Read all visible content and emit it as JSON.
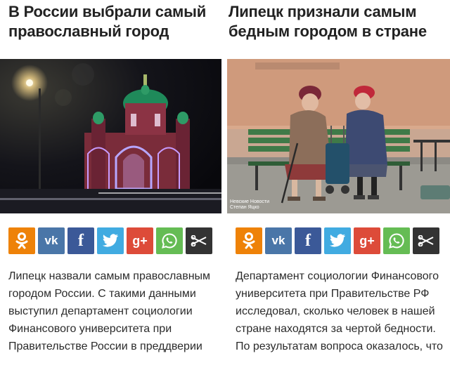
{
  "articles": [
    {
      "title": "В России выбрали самый православный город",
      "body": "Липецк назвали самым православным городом России. С такими данными выступил департамент социологии Финансового университета при Правительстве России в преддверии"
    },
    {
      "title": "Липецк признали самым бедным городом в стране",
      "body": "Департамент социологии Финансового университета при Правительстве РФ исследовал, сколько человек в нашей стране находятся за чертой бедности. По результатам вопроса оказалось, что",
      "photo_caption": "Невские Новости\nСтепан Яцко"
    }
  ],
  "share_buttons": [
    {
      "name": "odnoklassniki",
      "color": "#ee8208",
      "icon": "ok-icon"
    },
    {
      "name": "vkontakte",
      "color": "#4a76a8",
      "icon": "vk-icon"
    },
    {
      "name": "facebook",
      "color": "#3b5998",
      "icon": "facebook-icon"
    },
    {
      "name": "twitter",
      "color": "#41abe1",
      "icon": "twitter-icon"
    },
    {
      "name": "google-plus",
      "color": "#dd4b39",
      "icon": "google-plus-icon"
    },
    {
      "name": "whatsapp",
      "color": "#65bc54",
      "icon": "whatsapp-icon"
    },
    {
      "name": "more",
      "color": "#333333",
      "icon": "scissors-icon"
    }
  ],
  "share_labels": {
    "vk": "vk",
    "facebook": "f",
    "google_plus": "g+"
  }
}
